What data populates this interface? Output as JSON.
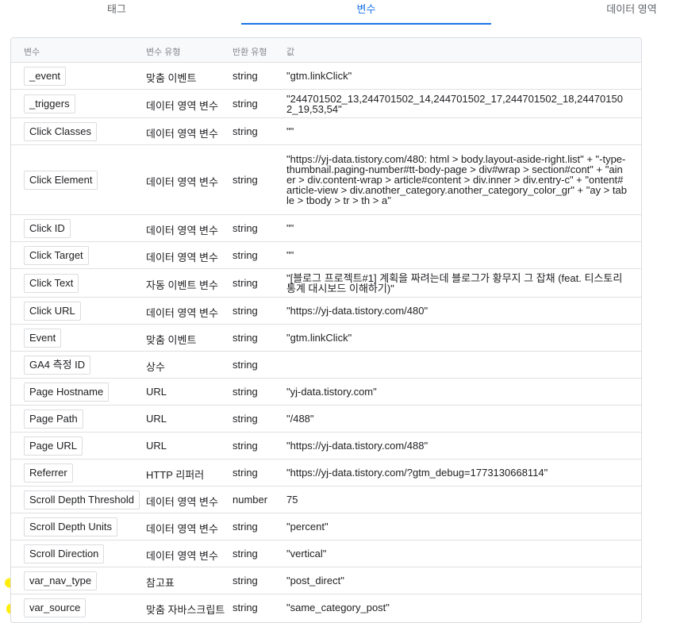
{
  "tabs": [
    "태그",
    "변수",
    "데이터 영역"
  ],
  "headers": {
    "variable": "변수",
    "type": "변수 유형",
    "return": "반환 유형",
    "value": "값"
  },
  "rows": [
    {
      "name": "_event",
      "type": "맞춤 이벤트",
      "ret": "string",
      "val": "\"gtm.linkClick\""
    },
    {
      "name": "_triggers",
      "type": "데이터 영역 변수",
      "ret": "string",
      "val": "\"244701502_13,244701502_14,244701502_17,244701502_18,244701502_19,53,54\""
    },
    {
      "name": "Click Classes",
      "type": "데이터 영역 변수",
      "ret": "string",
      "val": "\"\""
    },
    {
      "name": "Click Element",
      "type": "데이터 영역 변수",
      "ret": "string",
      "val": "\"https://yj-data.tistory.com/480: html > body.layout-aside-right.list\" + \"-type-thumbnail.paging-number#tt-body-page > div#wrap > section#cont\" + \"ainer > div.content-wrap > article#content > div.inner > div.entry-c\" + \"ontent#article-view > div.another_category.another_category_color_gr\" + \"ay > table > tbody > tr > th > a\""
    },
    {
      "name": "Click ID",
      "type": "데이터 영역 변수",
      "ret": "string",
      "val": "\"\""
    },
    {
      "name": "Click Target",
      "type": "데이터 영역 변수",
      "ret": "string",
      "val": "\"\""
    },
    {
      "name": "Click Text",
      "type": "자동 이벤트 변수",
      "ret": "string",
      "val": "\"[블로그 프로젝트#1] 계획을 짜려는데 블로그가 황무지 그 잡채 (feat. 티스토리 통계 대시보드 이해하기)\""
    },
    {
      "name": "Click URL",
      "type": "데이터 영역 변수",
      "ret": "string",
      "val": "\"https://yj-data.tistory.com/480\""
    },
    {
      "name": "Event",
      "type": "맞춤 이벤트",
      "ret": "string",
      "val": "\"gtm.linkClick\""
    },
    {
      "name": "GA4 측정 ID",
      "type": "상수",
      "ret": "string",
      "val": ""
    },
    {
      "name": "Page Hostname",
      "type": "URL",
      "ret": "string",
      "val": "\"yj-data.tistory.com\""
    },
    {
      "name": "Page Path",
      "type": "URL",
      "ret": "string",
      "val": "\"/488\""
    },
    {
      "name": "Page URL",
      "type": "URL",
      "ret": "string",
      "val": "\"https://yj-data.tistory.com/488\""
    },
    {
      "name": "Referrer",
      "type": "HTTP 리퍼러",
      "ret": "string",
      "val": "\"https://yj-data.tistory.com/?gtm_debug=1773130668114\""
    },
    {
      "name": "Scroll Depth Threshold",
      "type": "데이터 영역 변수",
      "ret": "number",
      "val": "75"
    },
    {
      "name": "Scroll Depth Units",
      "type": "데이터 영역 변수",
      "ret": "string",
      "val": "\"percent\""
    },
    {
      "name": "Scroll Direction",
      "type": "데이터 영역 변수",
      "ret": "string",
      "val": "\"vertical\""
    },
    {
      "name": "var_nav_type",
      "type": "참고표",
      "ret": "string",
      "val": "\"post_direct\""
    },
    {
      "name": "var_source",
      "type": "맞춤 자바스크립트",
      "ret": "string",
      "val": "\"same_category_post\""
    }
  ],
  "colors": {
    "accent": "#1a73e8",
    "highlight": "#ffec00"
  }
}
